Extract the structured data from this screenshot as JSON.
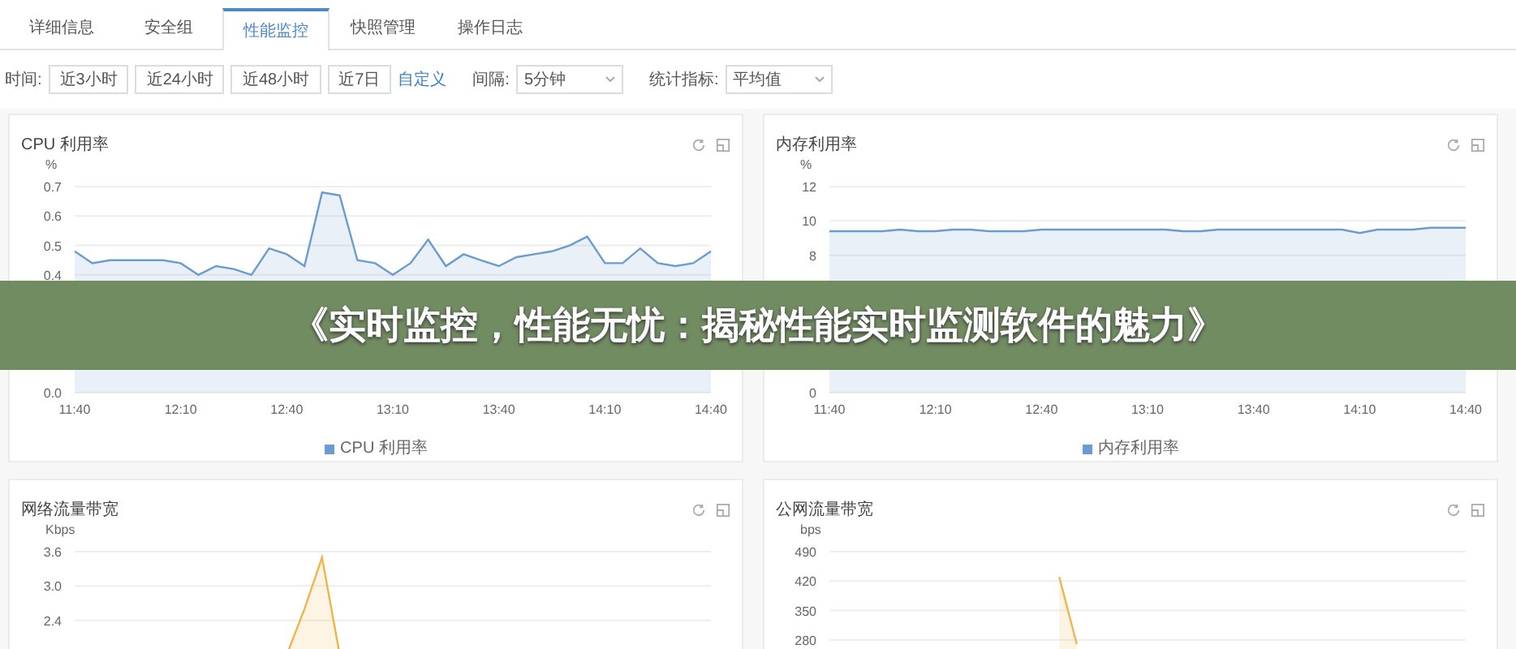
{
  "tabs": [
    {
      "label": "详细信息",
      "selected": false
    },
    {
      "label": "安全组",
      "selected": false
    },
    {
      "label": "性能监控",
      "selected": true
    },
    {
      "label": "快照管理",
      "selected": false
    },
    {
      "label": "操作日志",
      "selected": false
    }
  ],
  "filter": {
    "time_label": "时间:",
    "ranges": [
      "近3小时",
      "近24小时",
      "近48小时",
      "近7日"
    ],
    "custom_link": "自定义",
    "interval": {
      "label": "间隔:",
      "value": "5分钟"
    },
    "metric": {
      "label": "统计指标:",
      "value": "平均值"
    }
  },
  "cards": [
    {
      "title": "CPU 利用率",
      "unit": "%",
      "chart_data": {
        "type": "area",
        "grid": true,
        "ylim": [
          0,
          0.7
        ],
        "yticks": [
          {
            "value": 0,
            "label": "0.0"
          },
          0.4,
          0.5,
          0.6,
          0.7
        ],
        "categories": [
          "11:40",
          null,
          null,
          null,
          null,
          null,
          "12:10",
          null,
          null,
          null,
          null,
          null,
          "12:40",
          null,
          null,
          null,
          null,
          null,
          "13:10",
          null,
          null,
          null,
          null,
          null,
          "13:40",
          null,
          null,
          null,
          null,
          null,
          "14:10",
          null,
          null,
          null,
          null,
          null,
          "14:40"
        ],
        "series": [
          {
            "name": "CPU 利用率",
            "color": "#6a9bd1",
            "values": [
              0.48,
              0.44,
              0.45,
              0.45,
              0.45,
              0.45,
              0.44,
              0.4,
              0.43,
              0.42,
              0.4,
              0.49,
              0.47,
              0.43,
              0.68,
              0.67,
              0.45,
              0.44,
              0.4,
              0.44,
              0.52,
              0.43,
              0.47,
              0.45,
              0.43,
              0.46,
              0.47,
              0.48,
              0.5,
              0.53,
              0.44,
              0.44,
              0.49,
              0.44,
              0.43,
              0.44,
              0.48
            ]
          }
        ]
      }
    },
    {
      "title": "内存利用率",
      "unit": "%",
      "chart_data": {
        "type": "area",
        "grid": true,
        "ylim": [
          0,
          12
        ],
        "yticks": [
          0,
          8,
          10,
          12
        ],
        "categories": [
          "11:40",
          null,
          null,
          null,
          null,
          null,
          "12:10",
          null,
          null,
          null,
          null,
          null,
          "12:40",
          null,
          null,
          null,
          null,
          null,
          "13:10",
          null,
          null,
          null,
          null,
          null,
          "13:40",
          null,
          null,
          null,
          null,
          null,
          "14:10",
          null,
          null,
          null,
          null,
          null,
          "14:40"
        ],
        "series": [
          {
            "name": "内存利用率",
            "color": "#6a9bd1",
            "values": [
              9.4,
              9.4,
              9.4,
              9.4,
              9.5,
              9.4,
              9.4,
              9.5,
              9.5,
              9.4,
              9.4,
              9.4,
              9.5,
              9.5,
              9.5,
              9.5,
              9.5,
              9.5,
              9.5,
              9.5,
              9.4,
              9.4,
              9.5,
              9.5,
              9.5,
              9.5,
              9.5,
              9.5,
              9.5,
              9.5,
              9.3,
              9.5,
              9.5,
              9.5,
              9.6,
              9.6,
              9.6
            ]
          }
        ]
      }
    },
    {
      "title": "网络流量带宽",
      "unit": "Kbps",
      "chart_data": {
        "type": "area",
        "grid": true,
        "ylim": [
          0,
          3.6
        ],
        "yticks": [
          2.4,
          {
            "value": 3,
            "label": "3.0"
          },
          3.6
        ],
        "series": [
          {
            "color": "#f0b44c",
            "values": [
              null,
              null,
              null,
              null,
              null,
              null,
              null,
              null,
              null,
              null,
              null,
              null,
              1.8,
              2.6,
              3.5,
              1.8,
              null,
              null,
              null,
              null,
              null,
              null,
              null,
              null,
              null,
              null,
              null,
              null,
              null,
              null,
              null,
              null,
              null,
              null,
              null,
              null,
              null
            ]
          }
        ]
      }
    },
    {
      "title": "公网流量带宽",
      "unit": "bps",
      "chart_data": {
        "type": "area",
        "grid": true,
        "ylim": [
          0,
          490
        ],
        "yticks": [
          280,
          350,
          420,
          490
        ],
        "series": [
          {
            "color": "#f0b44c",
            "values": [
              null,
              null,
              null,
              null,
              null,
              null,
              null,
              null,
              null,
              null,
              null,
              null,
              null,
              430,
              270,
              null,
              null,
              null,
              null,
              null,
              null,
              null,
              null,
              null,
              null,
              null,
              null,
              null,
              null,
              null,
              null,
              null,
              null,
              null,
              null,
              null,
              null
            ]
          }
        ]
      }
    }
  ],
  "banner": {
    "text": "《实时监控，性能无忧：揭秘性能实时监测软件的魅力》"
  }
}
